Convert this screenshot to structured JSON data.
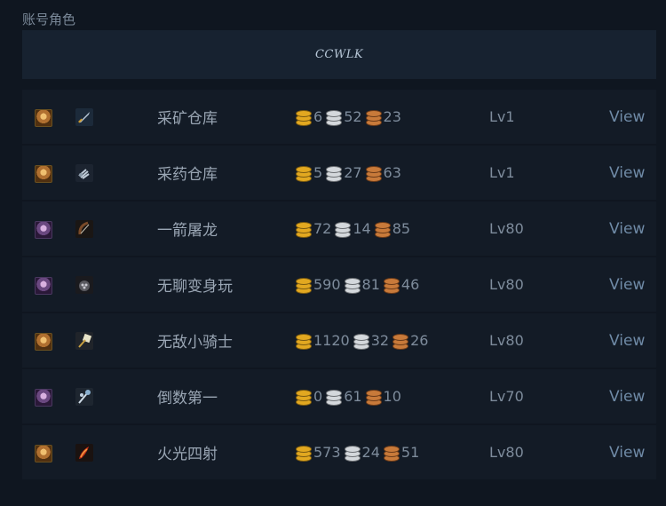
{
  "section_title": "账号角色",
  "realm": "CCWLK",
  "characters": [
    {
      "race": "human",
      "class_icon": "sword-icon",
      "name": "采矿仓库",
      "gold": "6",
      "silver": "52",
      "copper": "23",
      "level": "Lv1",
      "action": "View"
    },
    {
      "race": "human",
      "class_icon": "claw-icon",
      "name": "采药仓库",
      "gold": "5",
      "silver": "27",
      "copper": "63",
      "level": "Lv1",
      "action": "View"
    },
    {
      "race": "elf",
      "class_icon": "bow-icon",
      "name": "一箭屠龙",
      "gold": "72",
      "silver": "14",
      "copper": "85",
      "level": "Lv80",
      "action": "View"
    },
    {
      "race": "elf",
      "class_icon": "paw-icon",
      "name": "无聊变身玩",
      "gold": "590",
      "silver": "81",
      "copper": "46",
      "level": "Lv80",
      "action": "View"
    },
    {
      "race": "human",
      "class_icon": "hammer-icon",
      "name": "无敌小骑士",
      "gold": "1120",
      "silver": "32",
      "copper": "26",
      "level": "Lv80",
      "action": "View"
    },
    {
      "race": "elf",
      "class_icon": "staff-icon",
      "name": "倒数第一",
      "gold": "0",
      "silver": "61",
      "copper": "10",
      "level": "Lv70",
      "action": "View"
    },
    {
      "race": "human",
      "class_icon": "flame-icon",
      "name": "火光四射",
      "gold": "573",
      "silver": "24",
      "copper": "51",
      "level": "Lv80",
      "action": "View"
    }
  ]
}
